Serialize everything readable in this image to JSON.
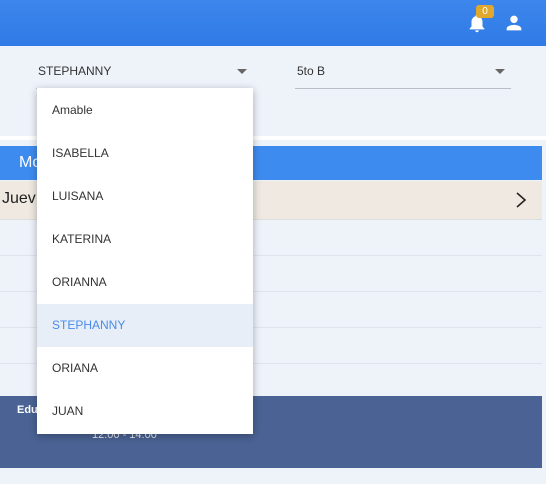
{
  "header": {
    "notifications_count": "0",
    "bell_icon": "bell-icon",
    "user_icon": "user-icon"
  },
  "filters": {
    "student_select": {
      "value": "STEPHANNY"
    },
    "section_select": {
      "value": "5to B"
    }
  },
  "student_options": [
    {
      "label": "Amable",
      "selected": false
    },
    {
      "label": "ISABELLA",
      "selected": false
    },
    {
      "label": "LUISANA",
      "selected": false
    },
    {
      "label": "KATERINA",
      "selected": false
    },
    {
      "label": "ORIANNA",
      "selected": false
    },
    {
      "label": "STEPHANNY",
      "selected": true
    },
    {
      "label": "ORIANA",
      "selected": false
    },
    {
      "label": "JUAN",
      "selected": false
    }
  ],
  "schedule": {
    "header_title": "Mo",
    "day_label": "Juev",
    "event": {
      "name": "Edu",
      "time": "12:00 - 14:00"
    }
  },
  "colors": {
    "primary": "#3e8bef",
    "badge": "#e0a92e",
    "selected_option": "#4a8be8",
    "event_card": "#4a6394"
  }
}
